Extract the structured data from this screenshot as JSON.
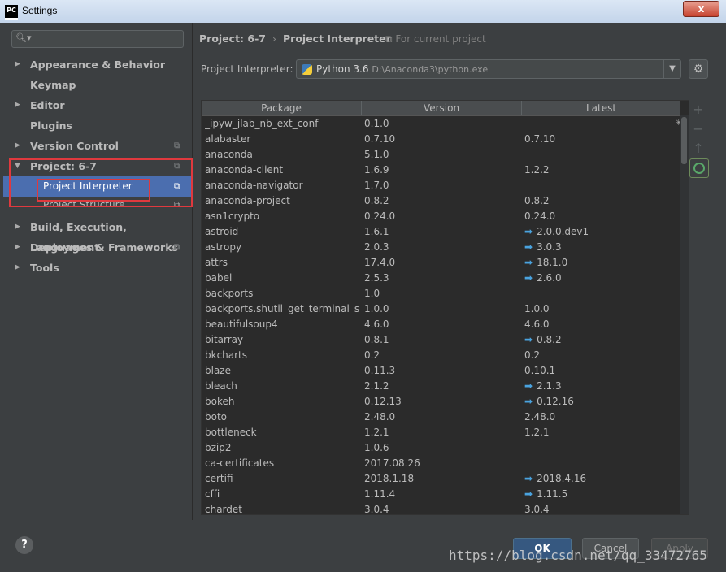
{
  "window": {
    "title": "Settings",
    "app_icon": "PC",
    "close_glyph": "x"
  },
  "sidebar": {
    "items": [
      {
        "label": "Appearance & Behavior",
        "arrow": "▶"
      },
      {
        "label": "Keymap",
        "arrow": ""
      },
      {
        "label": "Editor",
        "arrow": "▶"
      },
      {
        "label": "Plugins",
        "arrow": ""
      },
      {
        "label": "Version Control",
        "arrow": "▶"
      },
      {
        "label": "Project: 6-7",
        "arrow": "▼"
      },
      {
        "label": "Project Interpreter"
      },
      {
        "label": "Project Structure"
      },
      {
        "label": "Build, Execution, Deployment",
        "arrow": "▶"
      },
      {
        "label": "Languages & Frameworks",
        "arrow": "▶"
      },
      {
        "label": "Tools",
        "arrow": "▶"
      }
    ]
  },
  "breadcrumb": {
    "project": "Project: 6-7",
    "page": "Project Interpreter",
    "for_current": "For current project"
  },
  "interpreter": {
    "label": "Project Interpreter:",
    "name": "Python 3.6",
    "path": "D:\\Anaconda3\\python.exe"
  },
  "table": {
    "columns": [
      "Package",
      "Version",
      "Latest"
    ],
    "rows": [
      {
        "pkg": "_ipyw_jlab_nb_ext_conf",
        "ver": "0.1.0",
        "latest": "",
        "upgrade": false
      },
      {
        "pkg": "alabaster",
        "ver": "0.7.10",
        "latest": "0.7.10",
        "upgrade": false
      },
      {
        "pkg": "anaconda",
        "ver": "5.1.0",
        "latest": "",
        "upgrade": false
      },
      {
        "pkg": "anaconda-client",
        "ver": "1.6.9",
        "latest": "1.2.2",
        "upgrade": false
      },
      {
        "pkg": "anaconda-navigator",
        "ver": "1.7.0",
        "latest": "",
        "upgrade": false
      },
      {
        "pkg": "anaconda-project",
        "ver": "0.8.2",
        "latest": "0.8.2",
        "upgrade": false
      },
      {
        "pkg": "asn1crypto",
        "ver": "0.24.0",
        "latest": "0.24.0",
        "upgrade": false
      },
      {
        "pkg": "astroid",
        "ver": "1.6.1",
        "latest": "2.0.0.dev1",
        "upgrade": true
      },
      {
        "pkg": "astropy",
        "ver": "2.0.3",
        "latest": "3.0.3",
        "upgrade": true
      },
      {
        "pkg": "attrs",
        "ver": "17.4.0",
        "latest": "18.1.0",
        "upgrade": true
      },
      {
        "pkg": "babel",
        "ver": "2.5.3",
        "latest": "2.6.0",
        "upgrade": true
      },
      {
        "pkg": "backports",
        "ver": "1.0",
        "latest": "",
        "upgrade": false
      },
      {
        "pkg": "backports.shutil_get_terminal_s...",
        "ver": "1.0.0",
        "latest": "1.0.0",
        "upgrade": false
      },
      {
        "pkg": "beautifulsoup4",
        "ver": "4.6.0",
        "latest": "4.6.0",
        "upgrade": false
      },
      {
        "pkg": "bitarray",
        "ver": "0.8.1",
        "latest": "0.8.2",
        "upgrade": true
      },
      {
        "pkg": "bkcharts",
        "ver": "0.2",
        "latest": "0.2",
        "upgrade": false
      },
      {
        "pkg": "blaze",
        "ver": "0.11.3",
        "latest": "0.10.1",
        "upgrade": false
      },
      {
        "pkg": "bleach",
        "ver": "2.1.2",
        "latest": "2.1.3",
        "upgrade": true
      },
      {
        "pkg": "bokeh",
        "ver": "0.12.13",
        "latest": "0.12.16",
        "upgrade": true
      },
      {
        "pkg": "boto",
        "ver": "2.48.0",
        "latest": "2.48.0",
        "upgrade": false
      },
      {
        "pkg": "bottleneck",
        "ver": "1.2.1",
        "latest": "1.2.1",
        "upgrade": false
      },
      {
        "pkg": "bzip2",
        "ver": "1.0.6",
        "latest": "",
        "upgrade": false
      },
      {
        "pkg": "ca-certificates",
        "ver": "2017.08.26",
        "latest": "",
        "upgrade": false
      },
      {
        "pkg": "certifi",
        "ver": "2018.1.18",
        "latest": "2018.4.16",
        "upgrade": true
      },
      {
        "pkg": "cffi",
        "ver": "1.11.4",
        "latest": "1.11.5",
        "upgrade": true
      },
      {
        "pkg": "chardet",
        "ver": "3.0.4",
        "latest": "3.0.4",
        "upgrade": false
      }
    ]
  },
  "side_buttons": {
    "add": "+",
    "remove": "−",
    "upgrade": "↑"
  },
  "buttons": {
    "help": "?",
    "ok": "OK",
    "cancel": "Cancel",
    "apply": "Apply"
  },
  "watermark": "https://blog.csdn.net/qq_33472765",
  "colors": {
    "accent": "#4b6eaf",
    "upgrade_arrow": "#4aa3df",
    "highlight_box": "#e0393e"
  }
}
